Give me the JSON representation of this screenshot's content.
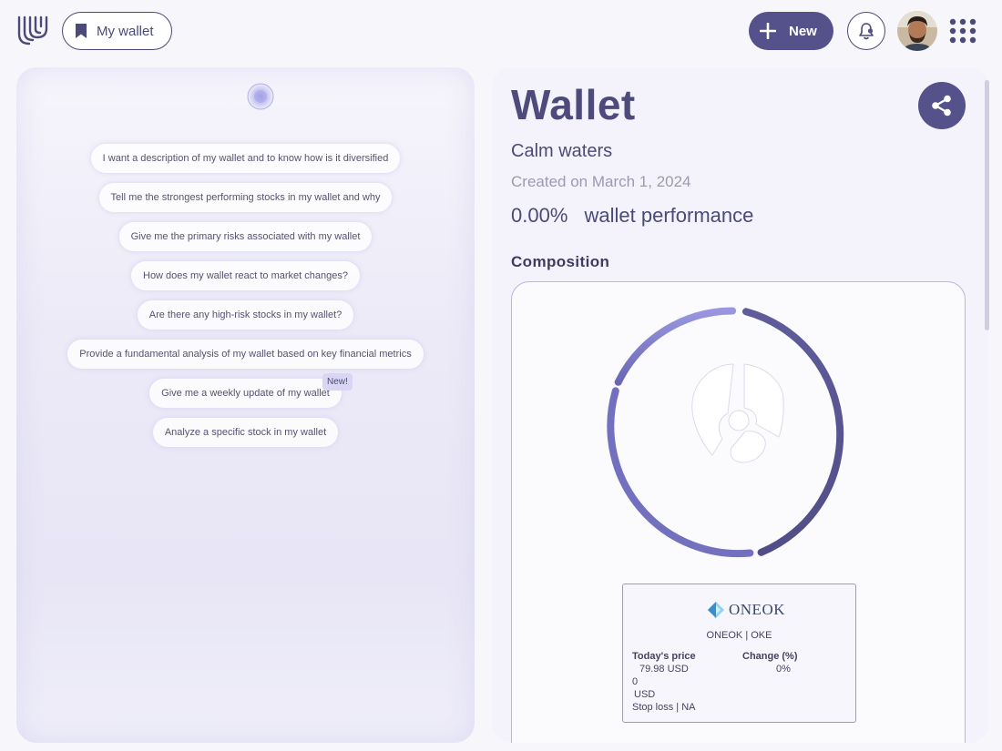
{
  "header": {
    "wallet_button_label": "My wallet",
    "new_button_label": "New"
  },
  "chat": {
    "suggestions": [
      "I want a description of my wallet and to know how is it diversified",
      "Tell me the strongest performing stocks in my wallet and why",
      "Give me the primary risks associated with my wallet",
      "How does my wallet react to market changes?",
      "Are there any high-risk stocks in my wallet?",
      "Provide a fundamental analysis of my wallet based on key financial metrics",
      "Give me a weekly update of my wallet",
      "Analyze a specific stock in my wallet"
    ],
    "new_badge": "New!"
  },
  "wallet": {
    "title": "Wallet",
    "subtitle": "Calm waters",
    "created": "Created on March 1, 2024",
    "performance_value": "0.00%",
    "performance_label": "wallet performance",
    "composition_title": "Composition"
  },
  "tooltip": {
    "brand": "ONEOK",
    "name_ticker": "ONEOK | OKE",
    "price_label": "Today's price",
    "price_value": "79.98 USD",
    "change_label": "Change (%)",
    "change_value": "0%",
    "line_zero": "0",
    "line_usd": "USD",
    "stop_loss": "Stop loss | NA"
  },
  "colors": {
    "primary": "#55518a",
    "donut_dark": "#55518a",
    "donut_light": "#8e8bd6"
  }
}
